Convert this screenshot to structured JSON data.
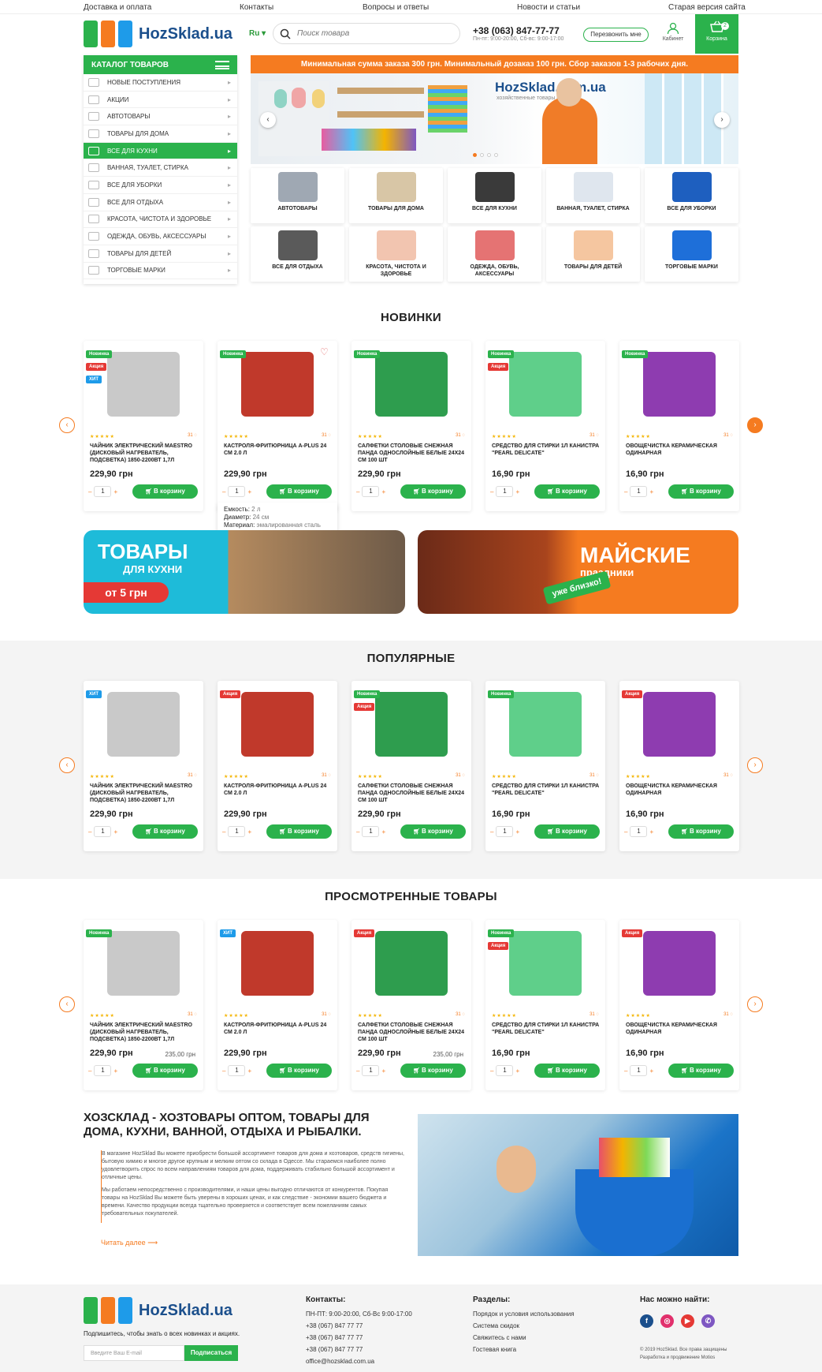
{
  "topnav": [
    "Доставка и оплата",
    "Контакты",
    "Вопросы и ответы",
    "Новости и статьи",
    "Старая версия сайта"
  ],
  "header": {
    "logo_text": "HozSklad.ua",
    "lang": "Ru",
    "search_placeholder": "Поиск товара",
    "phone": "+38 (063) 847-77-77",
    "hours": "Пн-пт: 9:00-20:00, Сб-вс: 9:00-17:00",
    "callback": "Перезвонить мне",
    "cabinet": "Кабинет",
    "cart": "Корзина",
    "cart_count": "2"
  },
  "catalog": {
    "title": "КАТАЛОГ ТОВАРОВ",
    "items": [
      "НОВЫЕ ПОСТУПЛЕНИЯ",
      "АКЦИИ",
      "АВТОТОВАРЫ",
      "ТОВАРЫ ДЛЯ ДОМА",
      "ВСЕ ДЛЯ КУХНИ",
      "ВАННАЯ, ТУАЛЕТ, СТИРКА",
      "ВСЕ ДЛЯ УБОРКИ",
      "ВСЕ ДЛЯ ОТДЫХА",
      "КРАСОТА, ЧИСТОТА И ЗДОРОВЬЕ",
      "ОДЕЖДА, ОБУВЬ, АКСЕССУАРЫ",
      "ТОВАРЫ ДЛЯ ДЕТЕЙ",
      "ТОРГОВЫЕ МАРКИ"
    ],
    "active_index": 4
  },
  "promo_bar": "Минимальная сумма заказа 300 грн. Минимальный дозаказ 100 грн. Сбор заказов 1-3 рабочих дня.",
  "hero": {
    "brand": "HozSklad.com.ua",
    "brand_sub": "хозяйственные товары оптом"
  },
  "categories": [
    "АВТОТОВАРЫ",
    "ТОВАРЫ ДЛЯ ДОМА",
    "ВСЕ ДЛЯ КУХНИ",
    "ВАННАЯ, ТУАЛЕТ, СТИРКА",
    "ВСЕ ДЛЯ УБОРКИ",
    "ВСЕ ДЛЯ ОТДЫХА",
    "КРАСОТА, ЧИСТОТА И ЗДОРОВЬЕ",
    "ОДЕЖДА, ОБУВЬ, АКСЕССУАРЫ",
    "ТОВАРЫ ДЛЯ ДЕТЕЙ",
    "ТОРГОВЫЕ МАРКИ"
  ],
  "sections": {
    "new": "НОВИНКИ",
    "popular": "ПОПУЛЯРНЫЕ",
    "viewed": "ПРОСМОТРЕННЫЕ ТОВАРЫ"
  },
  "labels": {
    "new": "Новинка",
    "sale": "Акция",
    "hit": "ХИТ",
    "buy": "В корзину",
    "qty": "1",
    "rev": "31",
    "stars": "★★★★★"
  },
  "products": [
    {
      "name": "ЧАЙНИК ЭЛЕКТРИЧЕСКИЙ MAESTRO (ДИСКОВЫЙ НАГРЕВАТЕЛЬ, ПОДСВЕТКА) 1850-2200ВТ 1,7Л",
      "price": "229,90 грн",
      "img": "#c9c9c9"
    },
    {
      "name": "КАСТРОЛЯ-ФРИТЮРНИЦА A-PLUS 24 СМ 2.0 Л",
      "price": "229,90 грн",
      "img": "#c0392b"
    },
    {
      "name": "САЛФЕТКИ СТОЛОВЫЕ СНЕЖНАЯ ПАНДА ОДНОСЛОЙНЫЕ БЕЛЫЕ 24Х24 СМ 100 ШТ",
      "price": "229,90 грн",
      "img": "#2e9d4e"
    },
    {
      "name": "СРЕДСТВО ДЛЯ СТИРКИ 1Л КАНИСТРА \"PEARL DELICATE\"",
      "price": "16,90 грн",
      "img": "#5fcf8a"
    },
    {
      "name": "ОВОЩЕЧИСТКА КЕРАМИЧЕСКАЯ ОДИНАРНАЯ",
      "price": "16,90 грн",
      "img": "#8e3cb0"
    }
  ],
  "new_labels": [
    [
      "Новинка",
      "Акция",
      "ХИТ"
    ],
    [
      "Новинка"
    ],
    [
      "Новинка"
    ],
    [
      "Новинка",
      "Акция"
    ],
    [
      "Новинка"
    ]
  ],
  "popular_labels": [
    [
      "ХИТ"
    ],
    [
      "Акция"
    ],
    [
      "Новинка",
      "Акция"
    ],
    [
      "Новинка"
    ],
    [
      "Акция"
    ]
  ],
  "viewed_labels": [
    [
      "Новинка"
    ],
    [
      "ХИТ"
    ],
    [
      "Акция"
    ],
    [
      "Новинка",
      "Акция"
    ],
    [
      "Акция"
    ]
  ],
  "viewed_old": [
    "235,00 грн",
    "",
    "235,00 грн",
    "",
    ""
  ],
  "popup": {
    "l1k": "Емкость:",
    "l1v": "2 л",
    "l2k": "Диаметр:",
    "l2v": "24 см",
    "l3k": "Материал:",
    "l3v": "эмалированная сталь"
  },
  "banner1": {
    "t1": "ТОВАРЫ",
    "t2": "ДЛЯ КУХНИ",
    "t3": "от 5 грн"
  },
  "banner2": {
    "t1": "МАЙСКИЕ",
    "t2": "праздники",
    "t3": "уже близко!"
  },
  "about": {
    "title": "ХОЗСКЛАД - ХОЗТОВАРЫ ОПТОМ, ТОВАРЫ ДЛЯ ДОМА, КУХНИ, ВАННОЙ, ОТДЫХА И РЫБАЛКИ.",
    "p1": "В магазине HozSklad Вы можете приобрести большой ассортимент товаров для дома и хозтоваров, средств гигиены, бытовую химию и многое другое крупным и мелким оптом со склада в Одессе. Мы стараемся наиболее полно удовлетворить спрос по всем направлениям товаров для дома, поддерживать стабильно большой ассортимент и отличные цены.",
    "p2": "Мы работаем непосредственно с производителями, и наши цены выгодно отличаются от конкурентов. Покупая товары на HozSklad Вы можете быть уверены в хороших ценах, и как следствие - экономии вашего бюджета и времени. Качество продукции всегда тщательно проверяется и соответствует всем пожеланиям самых требовательных покупателей.",
    "more": "Читать далее"
  },
  "footer": {
    "subscribe": "Подпишитесь, чтобы знать о всех новинках и акциях.",
    "email_placeholder": "Введите Ваш E-mail",
    "subscribe_btn": "Подписаться",
    "contacts_h": "Контакты:",
    "contacts": [
      "ПН-ПТ: 9:00-20:00, Сб-Вс 9:00-17:00",
      "+38 (067) 847 77 77",
      "+38 (067) 847 77 77",
      "+38 (067) 847 77 77",
      "office@hozsklad.com.ua"
    ],
    "sections_h": "Разделы:",
    "sections": [
      "Порядок и условия использования",
      "Система скидок",
      "Свяжитесь с нами",
      "Гостевая книга"
    ],
    "social_h": "Нас можно найти:",
    "copy1": "© 2019 HozSklad. Все права защищены",
    "copy2": "Разработка и продвижение Motios"
  },
  "colors": {
    "green": "#2bb24c",
    "orange": "#f57b20",
    "red": "#e53935",
    "blue": "#1e9be9"
  }
}
